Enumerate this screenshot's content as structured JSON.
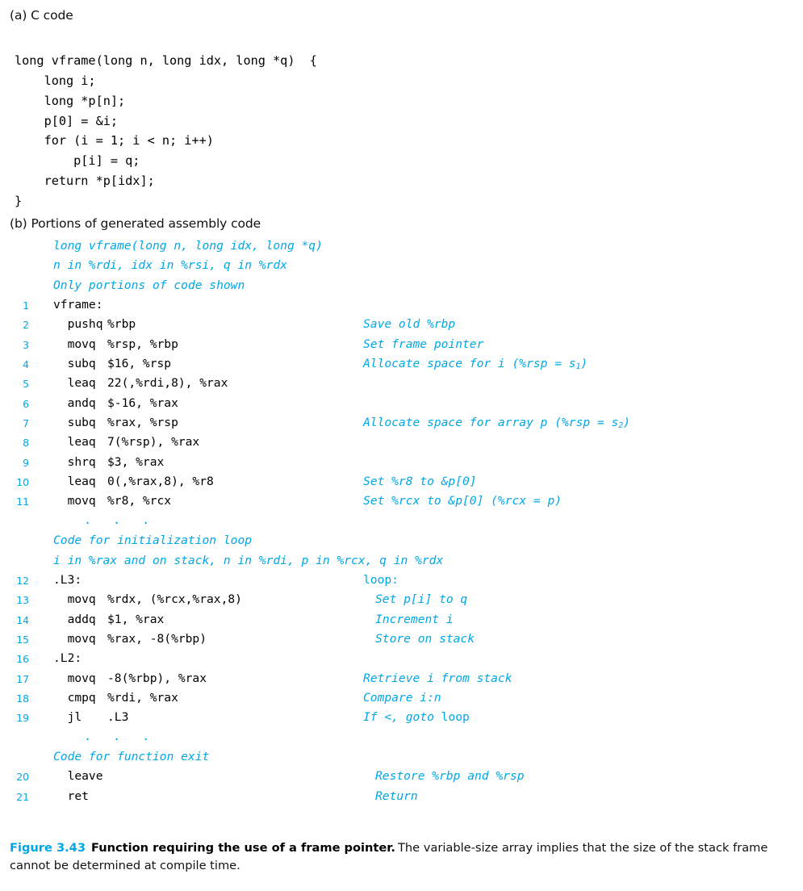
{
  "colors": {
    "accent_blue": "#00a7e6",
    "text_black": "#000000",
    "background": "#ffffff"
  },
  "sections": {
    "a_label": "(a) C code",
    "b_label": "(b) Portions of generated assembly code"
  },
  "c_code": "long vframe(long n, long idx, long *q)  {\n    long i;\n    long *p[n];\n    p[0] = &i;\n    for (i = 1; i < n; i++)\n        p[i] = q;\n    return *p[idx];\n}",
  "assembly": {
    "rows": [
      {
        "kind": "anno",
        "text": "long vframe(long n, long idx, long *q)"
      },
      {
        "kind": "anno",
        "text": "n in %rdi, idx in %rsi, q in %rdx"
      },
      {
        "kind": "anno",
        "text": "Only portions of code shown"
      },
      {
        "kind": "code",
        "lineno": "1",
        "mnem": "vframe:",
        "oper": "",
        "comment": ""
      },
      {
        "kind": "code",
        "lineno": "2",
        "mnem": "  pushq",
        "oper": "%rbp",
        "comment": "Save old %rbp"
      },
      {
        "kind": "code",
        "lineno": "3",
        "mnem": "  movq",
        "oper": "%rsp, %rbp",
        "comment": "Set frame pointer"
      },
      {
        "kind": "code",
        "lineno": "4",
        "mnem": "  subq",
        "oper": "$16, %rsp",
        "comment": "Allocate space for i (%rsp = s1)"
      },
      {
        "kind": "code",
        "lineno": "5",
        "mnem": "  leaq",
        "oper": "22(,%rdi,8), %rax",
        "comment": ""
      },
      {
        "kind": "code",
        "lineno": "6",
        "mnem": "  andq",
        "oper": "$-16, %rax",
        "comment": ""
      },
      {
        "kind": "code",
        "lineno": "7",
        "mnem": "  subq",
        "oper": "%rax, %rsp",
        "comment": "Allocate space for array p (%rsp = s2)"
      },
      {
        "kind": "code",
        "lineno": "8",
        "mnem": "  leaq",
        "oper": "7(%rsp), %rax",
        "comment": ""
      },
      {
        "kind": "code",
        "lineno": "9",
        "mnem": "  shrq",
        "oper": "$3, %rax",
        "comment": ""
      },
      {
        "kind": "code",
        "lineno": "10",
        "mnem": "  leaq",
        "oper": "0(,%rax,8), %r8",
        "comment": "Set %r8 to &p[0]"
      },
      {
        "kind": "code",
        "lineno": "11",
        "mnem": "  movq",
        "oper": "%r8, %rcx",
        "comment": "Set %rcx to &p[0] (%rcx = p)"
      },
      {
        "kind": "ellipsis",
        "text": ". . ."
      },
      {
        "kind": "anno",
        "text": "Code for initialization loop"
      },
      {
        "kind": "anno",
        "text": "i in %rax and on stack, n in %rdi, p in %rcx, q in %rdx"
      },
      {
        "kind": "code",
        "lineno": "12",
        "mnem": ".L3:",
        "oper": "",
        "comment": "loop:",
        "comment_upright": true
      },
      {
        "kind": "code",
        "lineno": "13",
        "mnem": "  movq",
        "oper": "%rdx, (%rcx,%rax,8)",
        "comment": "Set p[i] to q",
        "comment_indent": true
      },
      {
        "kind": "code",
        "lineno": "14",
        "mnem": "  addq",
        "oper": "$1, %rax",
        "comment": "Increment i",
        "comment_indent": true
      },
      {
        "kind": "code",
        "lineno": "15",
        "mnem": "  movq",
        "oper": "%rax, -8(%rbp)",
        "comment": "Store on stack",
        "comment_indent": true
      },
      {
        "kind": "code",
        "lineno": "16",
        "mnem": ".L2:",
        "oper": "",
        "comment": ""
      },
      {
        "kind": "code",
        "lineno": "17",
        "mnem": "  movq",
        "oper": "-8(%rbp), %rax",
        "comment": "Retrieve i from stack"
      },
      {
        "kind": "code",
        "lineno": "18",
        "mnem": "  cmpq",
        "oper": "%rdi, %rax",
        "comment": "Compare i:n"
      },
      {
        "kind": "code",
        "lineno": "19",
        "mnem": "  jl",
        "oper": ".L3",
        "comment": "If <, goto loop"
      },
      {
        "kind": "ellipsis",
        "text": ". . ."
      },
      {
        "kind": "anno",
        "text": "Code for function exit"
      },
      {
        "kind": "code",
        "lineno": "20",
        "mnem": "  leave",
        "oper": "",
        "comment": "Restore %rbp and %rsp",
        "comment_indent": true
      },
      {
        "kind": "code",
        "lineno": "21",
        "mnem": "  ret",
        "oper": "",
        "comment": "Return",
        "comment_indent": true
      }
    ]
  },
  "caption": {
    "number": "Figure 3.43",
    "title": "Function requiring the use of a frame pointer.",
    "text": "The variable-size array implies that the size of the stack frame cannot be determined at compile time."
  }
}
